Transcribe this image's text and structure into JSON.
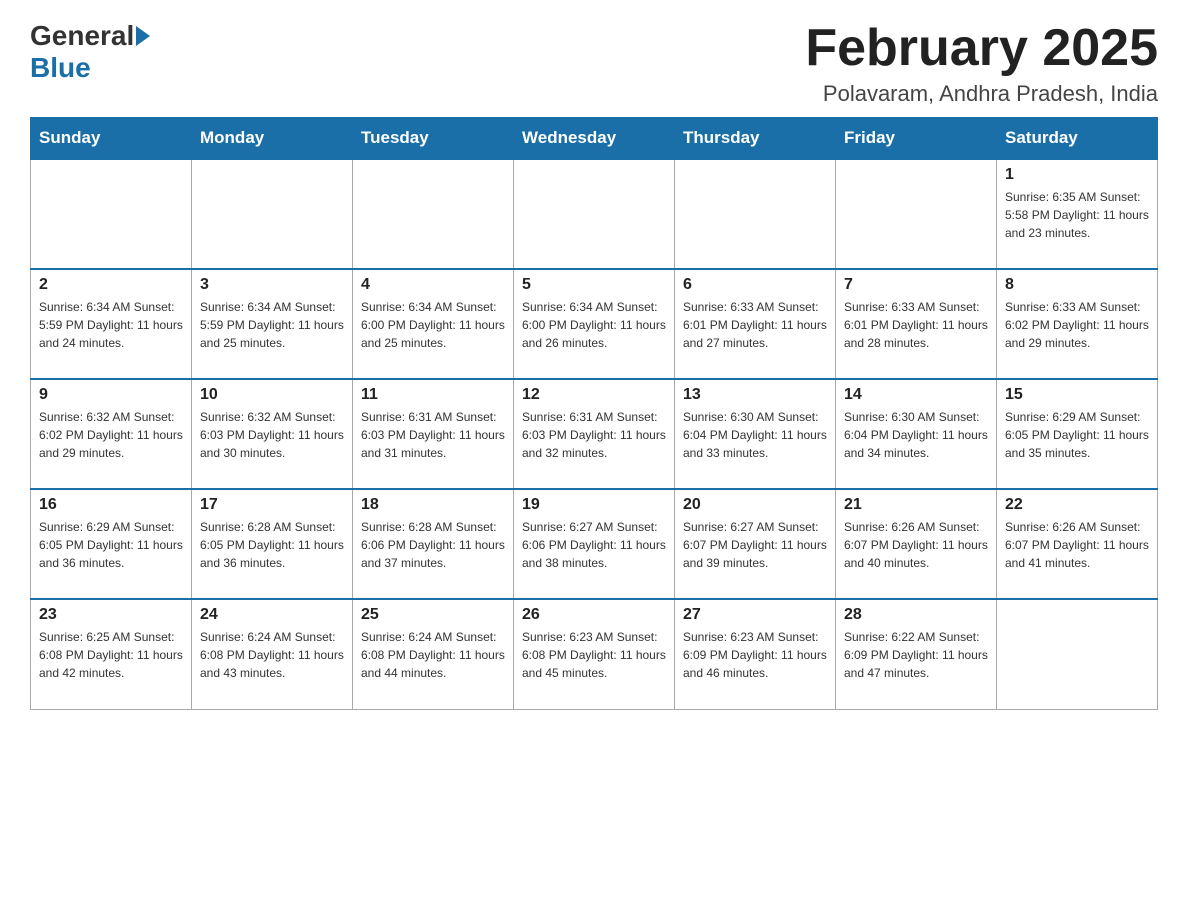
{
  "header": {
    "logo": {
      "general": "General",
      "blue": "Blue"
    },
    "title": "February 2025",
    "subtitle": "Polavaram, Andhra Pradesh, India"
  },
  "days_of_week": [
    "Sunday",
    "Monday",
    "Tuesday",
    "Wednesday",
    "Thursday",
    "Friday",
    "Saturday"
  ],
  "weeks": [
    [
      {
        "day": "",
        "info": ""
      },
      {
        "day": "",
        "info": ""
      },
      {
        "day": "",
        "info": ""
      },
      {
        "day": "",
        "info": ""
      },
      {
        "day": "",
        "info": ""
      },
      {
        "day": "",
        "info": ""
      },
      {
        "day": "1",
        "info": "Sunrise: 6:35 AM\nSunset: 5:58 PM\nDaylight: 11 hours and 23 minutes."
      }
    ],
    [
      {
        "day": "2",
        "info": "Sunrise: 6:34 AM\nSunset: 5:59 PM\nDaylight: 11 hours and 24 minutes."
      },
      {
        "day": "3",
        "info": "Sunrise: 6:34 AM\nSunset: 5:59 PM\nDaylight: 11 hours and 25 minutes."
      },
      {
        "day": "4",
        "info": "Sunrise: 6:34 AM\nSunset: 6:00 PM\nDaylight: 11 hours and 25 minutes."
      },
      {
        "day": "5",
        "info": "Sunrise: 6:34 AM\nSunset: 6:00 PM\nDaylight: 11 hours and 26 minutes."
      },
      {
        "day": "6",
        "info": "Sunrise: 6:33 AM\nSunset: 6:01 PM\nDaylight: 11 hours and 27 minutes."
      },
      {
        "day": "7",
        "info": "Sunrise: 6:33 AM\nSunset: 6:01 PM\nDaylight: 11 hours and 28 minutes."
      },
      {
        "day": "8",
        "info": "Sunrise: 6:33 AM\nSunset: 6:02 PM\nDaylight: 11 hours and 29 minutes."
      }
    ],
    [
      {
        "day": "9",
        "info": "Sunrise: 6:32 AM\nSunset: 6:02 PM\nDaylight: 11 hours and 29 minutes."
      },
      {
        "day": "10",
        "info": "Sunrise: 6:32 AM\nSunset: 6:03 PM\nDaylight: 11 hours and 30 minutes."
      },
      {
        "day": "11",
        "info": "Sunrise: 6:31 AM\nSunset: 6:03 PM\nDaylight: 11 hours and 31 minutes."
      },
      {
        "day": "12",
        "info": "Sunrise: 6:31 AM\nSunset: 6:03 PM\nDaylight: 11 hours and 32 minutes."
      },
      {
        "day": "13",
        "info": "Sunrise: 6:30 AM\nSunset: 6:04 PM\nDaylight: 11 hours and 33 minutes."
      },
      {
        "day": "14",
        "info": "Sunrise: 6:30 AM\nSunset: 6:04 PM\nDaylight: 11 hours and 34 minutes."
      },
      {
        "day": "15",
        "info": "Sunrise: 6:29 AM\nSunset: 6:05 PM\nDaylight: 11 hours and 35 minutes."
      }
    ],
    [
      {
        "day": "16",
        "info": "Sunrise: 6:29 AM\nSunset: 6:05 PM\nDaylight: 11 hours and 36 minutes."
      },
      {
        "day": "17",
        "info": "Sunrise: 6:28 AM\nSunset: 6:05 PM\nDaylight: 11 hours and 36 minutes."
      },
      {
        "day": "18",
        "info": "Sunrise: 6:28 AM\nSunset: 6:06 PM\nDaylight: 11 hours and 37 minutes."
      },
      {
        "day": "19",
        "info": "Sunrise: 6:27 AM\nSunset: 6:06 PM\nDaylight: 11 hours and 38 minutes."
      },
      {
        "day": "20",
        "info": "Sunrise: 6:27 AM\nSunset: 6:07 PM\nDaylight: 11 hours and 39 minutes."
      },
      {
        "day": "21",
        "info": "Sunrise: 6:26 AM\nSunset: 6:07 PM\nDaylight: 11 hours and 40 minutes."
      },
      {
        "day": "22",
        "info": "Sunrise: 6:26 AM\nSunset: 6:07 PM\nDaylight: 11 hours and 41 minutes."
      }
    ],
    [
      {
        "day": "23",
        "info": "Sunrise: 6:25 AM\nSunset: 6:08 PM\nDaylight: 11 hours and 42 minutes."
      },
      {
        "day": "24",
        "info": "Sunrise: 6:24 AM\nSunset: 6:08 PM\nDaylight: 11 hours and 43 minutes."
      },
      {
        "day": "25",
        "info": "Sunrise: 6:24 AM\nSunset: 6:08 PM\nDaylight: 11 hours and 44 minutes."
      },
      {
        "day": "26",
        "info": "Sunrise: 6:23 AM\nSunset: 6:08 PM\nDaylight: 11 hours and 45 minutes."
      },
      {
        "day": "27",
        "info": "Sunrise: 6:23 AM\nSunset: 6:09 PM\nDaylight: 11 hours and 46 minutes."
      },
      {
        "day": "28",
        "info": "Sunrise: 6:22 AM\nSunset: 6:09 PM\nDaylight: 11 hours and 47 minutes."
      },
      {
        "day": "",
        "info": ""
      }
    ]
  ]
}
